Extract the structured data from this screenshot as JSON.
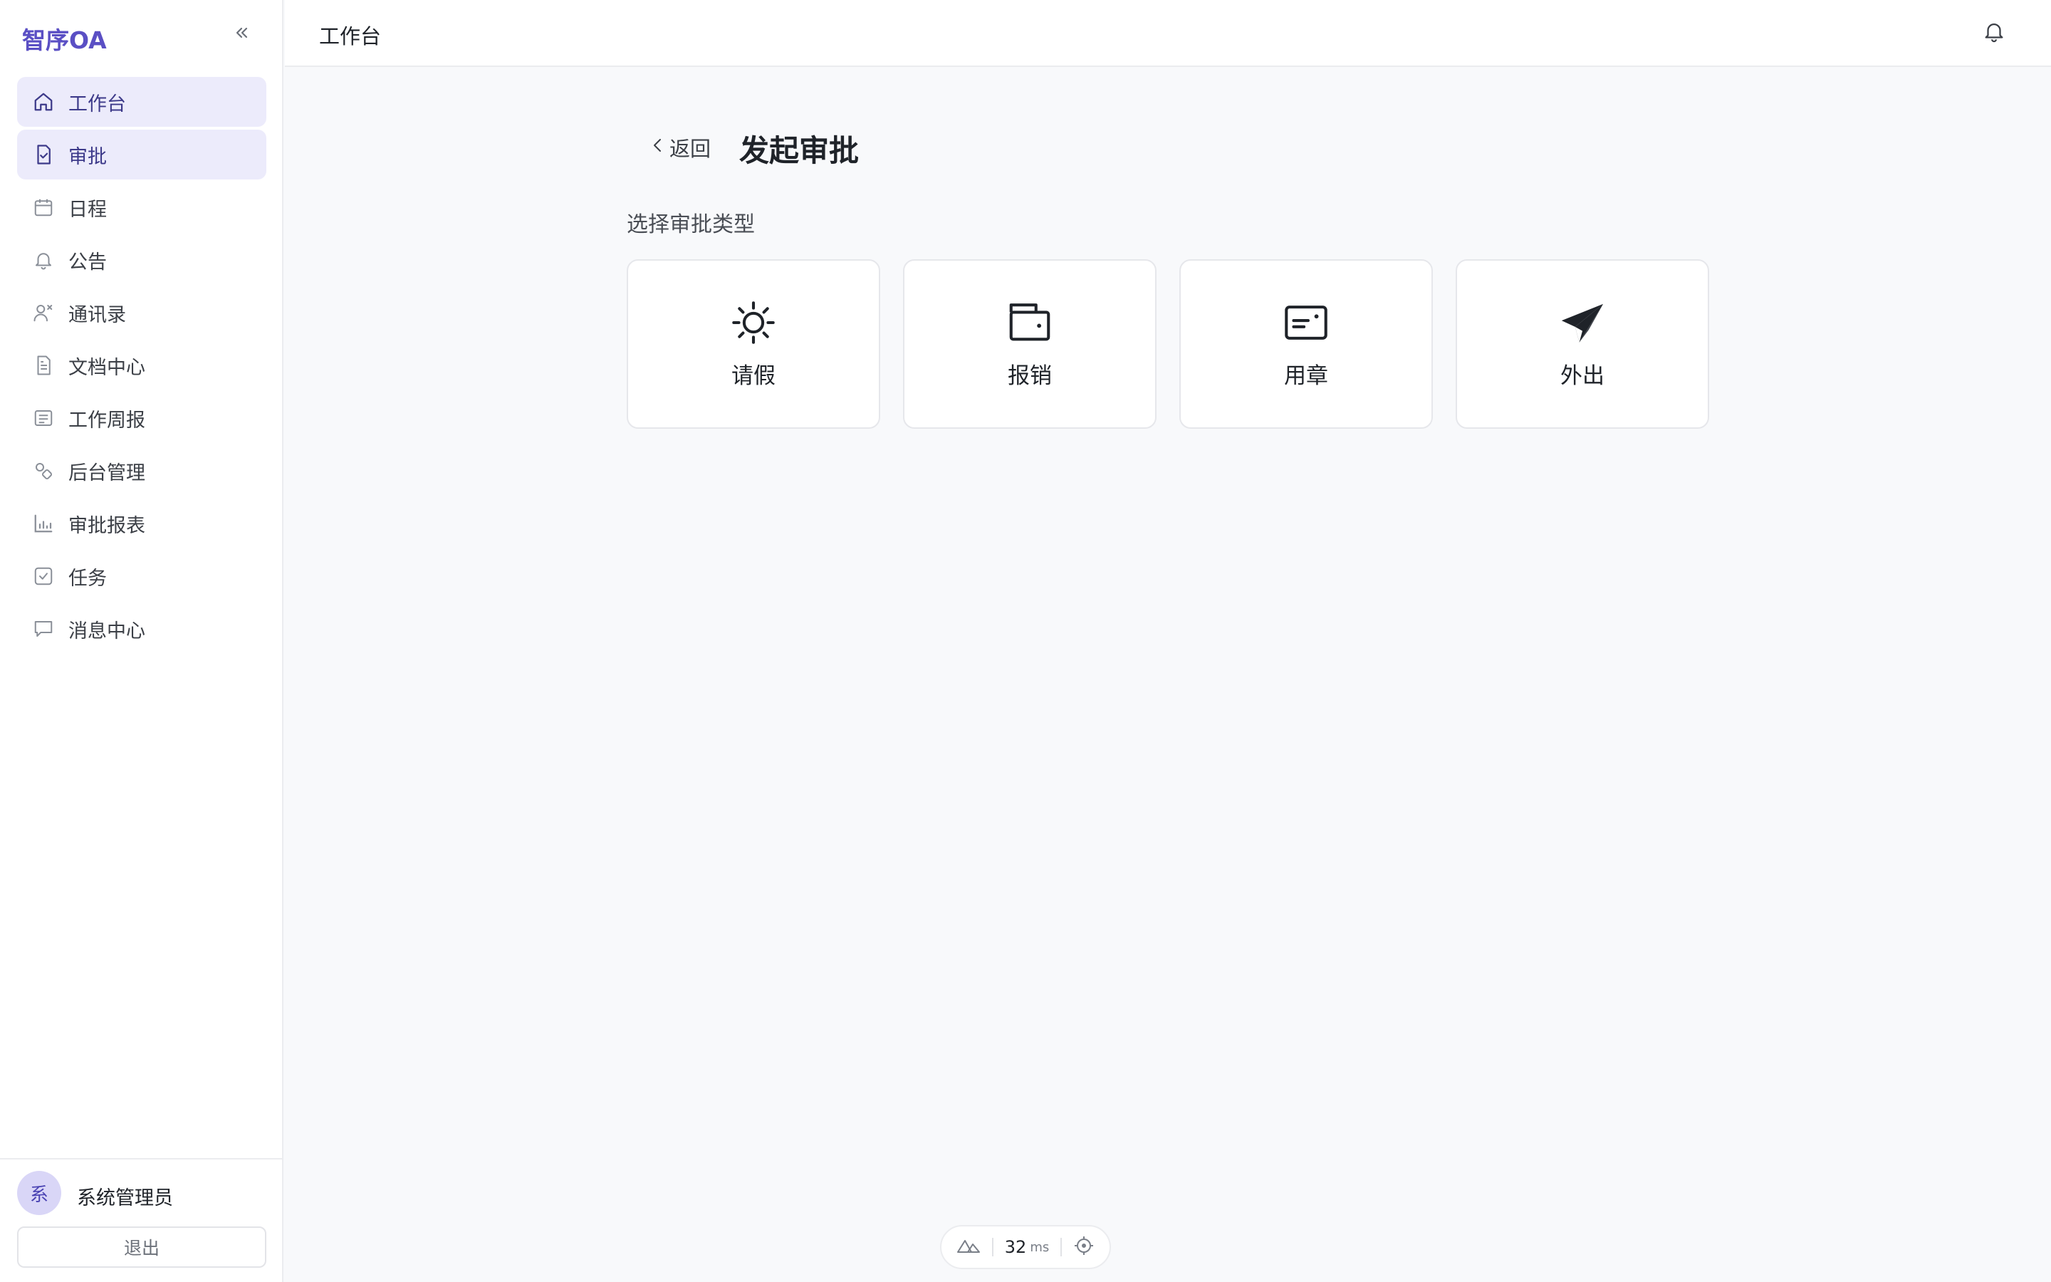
{
  "app": {
    "brand": "智序OA",
    "collapse_icon": "chevrons-left-icon"
  },
  "sidebar": {
    "items": [
      {
        "label": "工作台",
        "icon": "home-icon",
        "active": true
      },
      {
        "label": "审批",
        "icon": "file-check-icon",
        "active": true
      },
      {
        "label": "日程",
        "icon": "calendar-icon",
        "active": false
      },
      {
        "label": "公告",
        "icon": "bell-icon",
        "active": false
      },
      {
        "label": "通讯录",
        "icon": "contacts-icon",
        "active": false
      },
      {
        "label": "文档中心",
        "icon": "document-icon",
        "active": false
      },
      {
        "label": "工作周报",
        "icon": "list-icon",
        "active": false
      },
      {
        "label": "后台管理",
        "icon": "admin-icon",
        "active": false
      },
      {
        "label": "审批报表",
        "icon": "bar-chart-icon",
        "active": false
      },
      {
        "label": "任务",
        "icon": "checkbox-icon",
        "active": false
      },
      {
        "label": "消息中心",
        "icon": "message-icon",
        "active": false
      }
    ],
    "user": {
      "avatar_text": "系",
      "name": "系统管理员"
    },
    "logout_label": "退出"
  },
  "topbar": {
    "title": "工作台",
    "bell_icon": "bell-icon"
  },
  "main": {
    "back_label": "返回",
    "page_title": "发起审批",
    "section_label": "选择审批类型",
    "types": [
      {
        "label": "请假",
        "icon": "sun-icon"
      },
      {
        "label": "报销",
        "icon": "wallet-icon"
      },
      {
        "label": "用章",
        "icon": "card-icon"
      },
      {
        "label": "外出",
        "icon": "paper-plane-icon"
      }
    ]
  },
  "devtools": {
    "value": "32",
    "unit": "ms"
  },
  "colors": {
    "accent": "#5a4fc4",
    "active_bg": "#ecebfb",
    "page_bg": "#f8f9fb"
  }
}
